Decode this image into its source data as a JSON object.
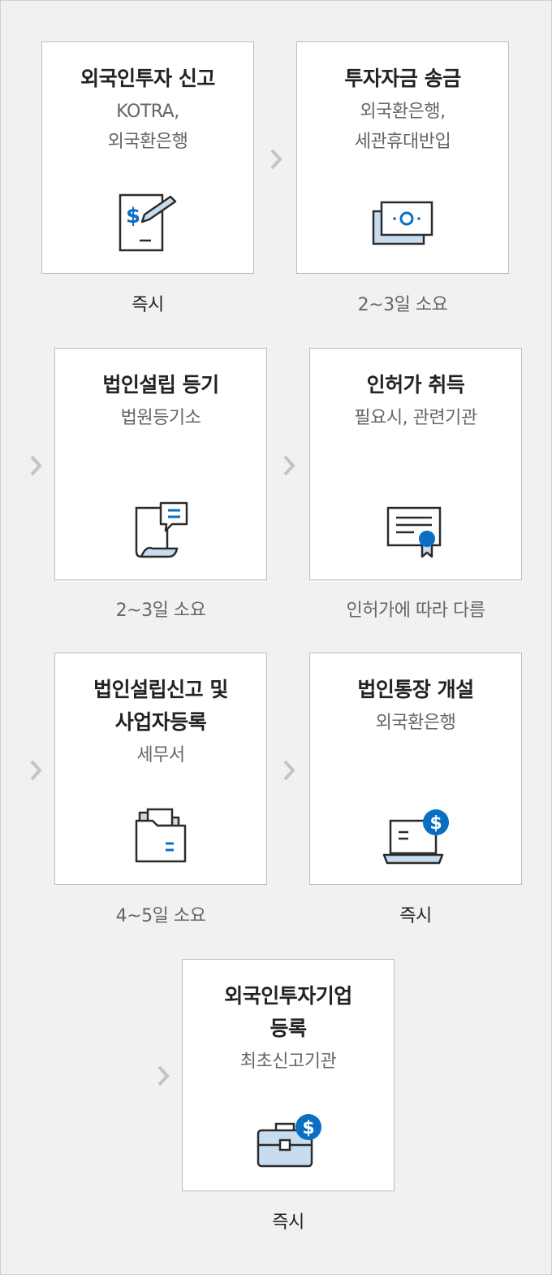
{
  "steps": [
    {
      "title": [
        "외국인투자 신고"
      ],
      "sub": [
        "KOTRA,",
        "외국환은행"
      ],
      "caption": "즉시",
      "icon": "document-dollar-pen-icon"
    },
    {
      "title": [
        "투자자금 송금"
      ],
      "sub": [
        "외국환은행,",
        "세관휴대반입"
      ],
      "caption": "2~3일 소요",
      "icon": "banknotes-icon"
    },
    {
      "title": [
        "법인설립 등기"
      ],
      "sub": [
        "법원등기소"
      ],
      "caption": "2~3일 소요",
      "icon": "scroll-speech-icon"
    },
    {
      "title": [
        "인허가 취득"
      ],
      "sub": [
        "필요시, 관련기관"
      ],
      "caption": "인허가에 따라 다름",
      "icon": "certificate-icon"
    },
    {
      "title": [
        "법인설립신고 및",
        "사업자등록"
      ],
      "sub": [
        "세무서"
      ],
      "caption": "4~5일 소요",
      "icon": "folder-icon"
    },
    {
      "title": [
        "법인통장 개설"
      ],
      "sub": [
        "외국환은행"
      ],
      "caption": "즉시",
      "icon": "laptop-dollar-icon"
    },
    {
      "title": [
        "외국인투자기업",
        "등록"
      ],
      "sub": [
        "최초신고기관"
      ],
      "caption": "즉시",
      "icon": "briefcase-dollar-icon"
    }
  ],
  "colors": {
    "accent": "#0a6fc2",
    "accent_light": "#c8dcf0",
    "border": "#bdbdbd",
    "arrow": "#c4c4c4"
  }
}
